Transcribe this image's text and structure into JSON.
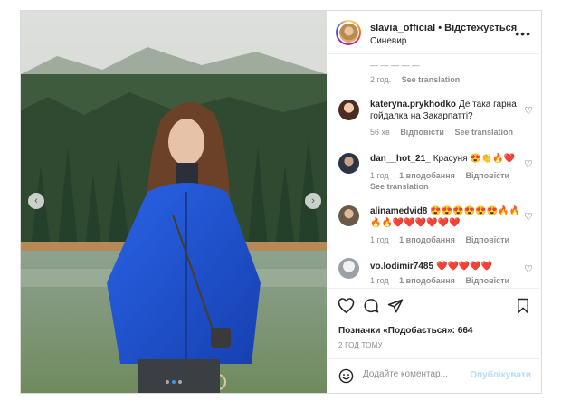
{
  "post": {
    "username": "slavia_official",
    "separator": "•",
    "follow_label": "Відстежується",
    "location": "Синевир",
    "more_icon": "more-horizontal-icon"
  },
  "comments": [
    {
      "user": "",
      "text": "",
      "meta": [
        "2 год."
      ],
      "secondary": "See translation",
      "has_avatar": false
    },
    {
      "user": "kateryna.prykhodko",
      "text": "Де така гарна гойдалка на Закарпатті?",
      "meta": [
        "56 хв",
        "Відповісти",
        "See translation"
      ]
    },
    {
      "user": "dan__hot_21_",
      "text": "Красуня 😍👏🔥❤️",
      "meta": [
        "1 год",
        "1 вподобання",
        "Відповісти"
      ],
      "secondary": "See translation"
    },
    {
      "user": "alinamedvid8",
      "text": "😍😍😍😍😍😍🔥🔥 🔥🔥❤️❤️❤️❤️❤️❤️",
      "meta": [
        "1 год",
        "1 вподобання",
        "Відповісти"
      ]
    },
    {
      "user": "vo.lodimir7485",
      "text": "❤️❤️❤️❤️❤️",
      "meta": [
        "1 год",
        "1 вподобання",
        "Відповісти"
      ]
    }
  ],
  "actions": {
    "likes_text": "Позначки «Подобається»: 664",
    "time_ago": "2 ГОД ТОМУ"
  },
  "composer": {
    "placeholder": "Додайте коментар...",
    "publish_label": "Опублікувати"
  },
  "carousel": {
    "prev_glyph": "‹",
    "next_glyph": "›",
    "dot_count": 3,
    "active_dot": 1
  },
  "colors": {
    "link_blue": "#3897f0",
    "disabled_blue": "#b3dbff",
    "jacket_blue": "#1b4fc9"
  }
}
